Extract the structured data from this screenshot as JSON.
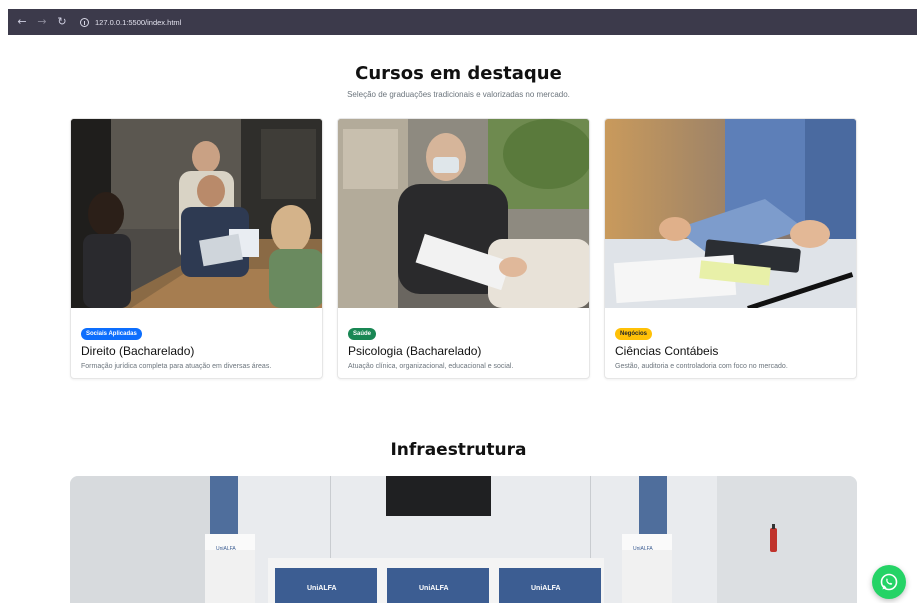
{
  "browser": {
    "back_icon": "arrow-left-icon",
    "forward_icon": "arrow-right-icon",
    "reload_icon": "reload-icon",
    "url": "127.0.0.1:5500/index.html"
  },
  "featured": {
    "title": "Cursos em destaque",
    "subtitle": "Seleção de graduações tradicionais e valorizadas no mercado.",
    "courses": [
      {
        "badge": "Sociais Aplicadas",
        "badge_color": "#0d6efd",
        "title": "Direito (Bacharelado)",
        "description": "Formação jurídica completa para atuação em diversas áreas."
      },
      {
        "badge": "Saúde",
        "badge_color": "#198754",
        "title": "Psicologia (Bacharelado)",
        "description": "Atuação clínica, organizacional, educacional e social."
      },
      {
        "badge": "Negócios",
        "badge_color": "#ffc107",
        "title": "Ciências Contábeis",
        "description": "Gestão, auditoria e controladoria com foco no mercado."
      }
    ]
  },
  "infrastructure": {
    "title": "Infraestrutura",
    "brand_labels": [
      "UniALFA",
      "UniALFA",
      "UniALFA",
      "UniALFA",
      "UniALFA"
    ]
  },
  "whatsapp": {
    "icon": "whatsapp-icon",
    "color": "#25d366"
  }
}
